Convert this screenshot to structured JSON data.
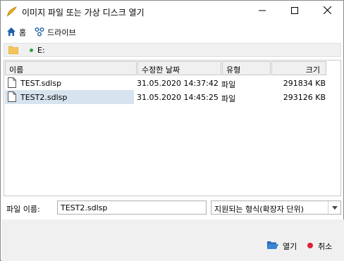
{
  "window": {
    "title": "이미지 파일 또는 가상 디스크 열기"
  },
  "quicknav": {
    "home_label": "홈",
    "drives_label": "드라이브"
  },
  "path": {
    "text": "E:"
  },
  "columns": {
    "name": "이름",
    "date": "수정한 날짜",
    "type": "유형",
    "size": "크기"
  },
  "files": [
    {
      "name": "TEST.sdlsp",
      "date": "31.05.2020 14:37:42",
      "type": "파일",
      "size": "291834 KB",
      "selected": false
    },
    {
      "name": "TEST2.sdlsp",
      "date": "31.05.2020 14:45:25",
      "type": "파일",
      "size": "293126 KB",
      "selected": true
    }
  ],
  "form": {
    "filename_label": "파일 이름:",
    "filename_value": "TEST2.sdlsp",
    "filter_value": "지원되는 형식(확장자 단위)"
  },
  "buttons": {
    "open_label": "열기",
    "cancel_label": "취소"
  },
  "colors": {
    "selection": "#d7e4ef",
    "home_icon": "#1f5fa8",
    "cancel_dot": "#e0203a",
    "drive_dot": "#2ea043"
  }
}
